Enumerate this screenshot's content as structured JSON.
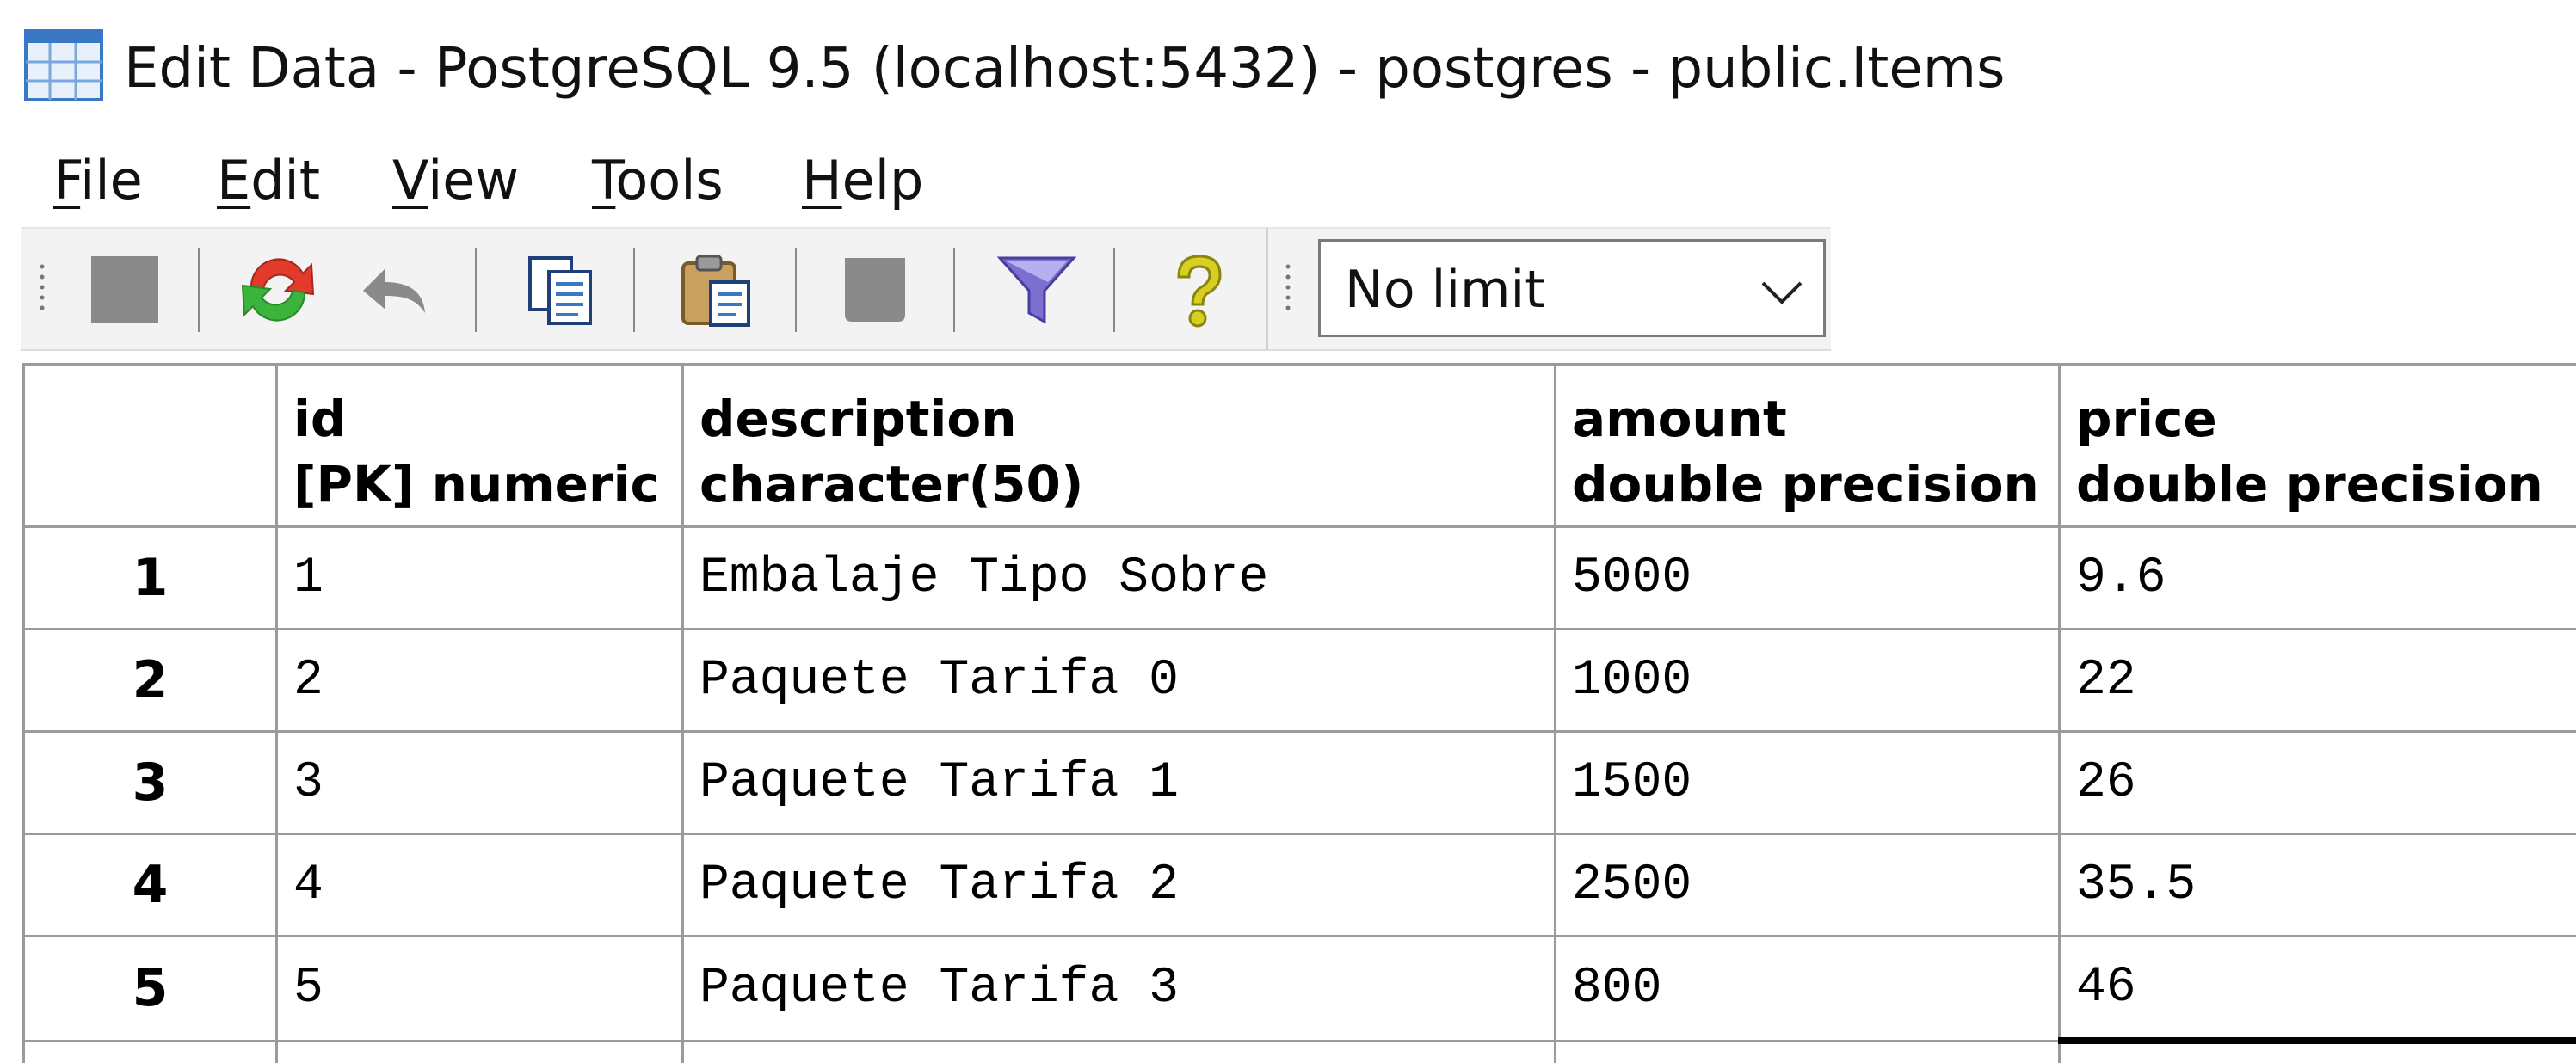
{
  "window": {
    "title": "Edit Data - PostgreSQL 9.5 (localhost:5432) - postgres - public.Items",
    "icon": "table-grid-icon"
  },
  "menu": {
    "items": [
      {
        "mnemonic": "F",
        "rest": "ile"
      },
      {
        "mnemonic": "E",
        "rest": "dit"
      },
      {
        "mnemonic": "V",
        "rest": "iew"
      },
      {
        "mnemonic": "T",
        "rest": "ools"
      },
      {
        "mnemonic": "H",
        "rest": "elp"
      }
    ]
  },
  "toolbar": {
    "buttons": [
      {
        "icon": "save-icon"
      },
      {
        "icon": "refresh-icon"
      },
      {
        "icon": "undo-icon"
      },
      {
        "icon": "copy-icon"
      },
      {
        "icon": "paste-icon"
      },
      {
        "icon": "delete-icon"
      },
      {
        "icon": "filter-icon"
      },
      {
        "icon": "help-icon"
      }
    ],
    "limit": {
      "value": "No limit"
    }
  },
  "grid": {
    "columns": [
      {
        "name": "id",
        "type": "[PK] numeric"
      },
      {
        "name": "description",
        "type": "character(50)"
      },
      {
        "name": "amount",
        "type": "double precision"
      },
      {
        "name": "price",
        "type": "double precision"
      }
    ],
    "rows": [
      {
        "num": "1",
        "id": "1",
        "description": "Embalaje Tipo Sobre",
        "amount": "5000",
        "price": "9.6"
      },
      {
        "num": "2",
        "id": "2",
        "description": "Paquete Tarifa 0",
        "amount": "1000",
        "price": "22"
      },
      {
        "num": "3",
        "id": "3",
        "description": "Paquete Tarifa 1",
        "amount": "1500",
        "price": "26"
      },
      {
        "num": "4",
        "id": "4",
        "description": "Paquete Tarifa 2",
        "amount": "2500",
        "price": "35.5"
      },
      {
        "num": "5",
        "id": "5",
        "description": "Paquete Tarifa 3",
        "amount": "800",
        "price": "46"
      }
    ]
  },
  "colors": {
    "grid_border": "#9b9b9b",
    "toolbar_bg": "#f3f3f3",
    "filter_icon": "#7b6fd0",
    "help_icon": "#d8d020",
    "refresh_red": "#e23b2c",
    "refresh_green": "#3cb43c"
  }
}
